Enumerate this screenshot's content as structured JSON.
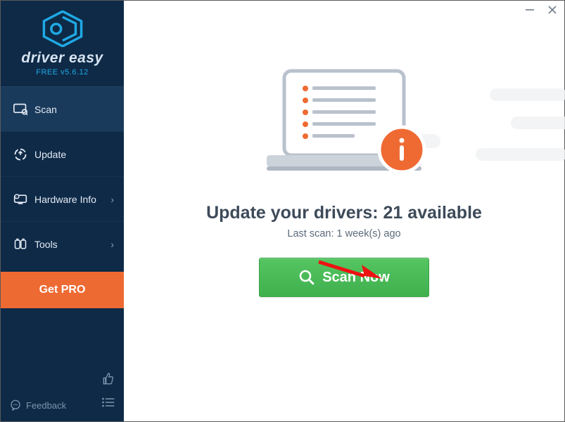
{
  "brand": {
    "line1": "driver",
    "line2": "easy"
  },
  "version": "FREE v5.6.12",
  "sidebar": {
    "items": [
      {
        "label": "Scan",
        "chev": false
      },
      {
        "label": "Update",
        "chev": false
      },
      {
        "label": "Hardware Info",
        "chev": true
      },
      {
        "label": "Tools",
        "chev": true
      }
    ],
    "get_pro": "Get PRO",
    "feedback": "Feedback"
  },
  "headline_prefix": "Update your drivers: ",
  "headline_count": "21",
  "headline_suffix": " available",
  "subline": "Last scan: 1 week(s) ago",
  "scan_button": "Scan Now",
  "chevron": "›"
}
